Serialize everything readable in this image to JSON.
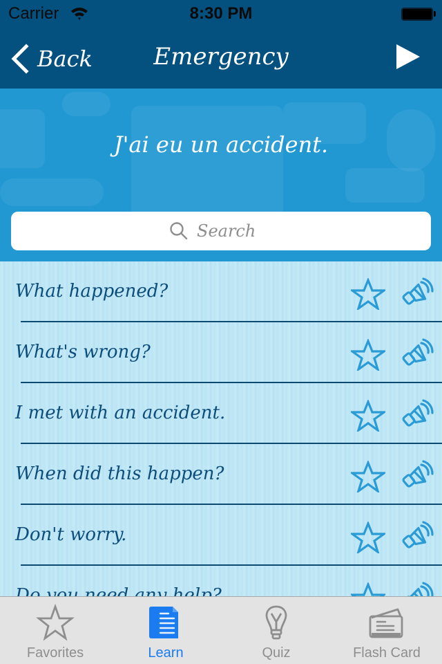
{
  "status_bar": {
    "carrier": "Carrier",
    "time": "8:30 PM"
  },
  "nav": {
    "back_label": "Back",
    "title": "Emergency",
    "play_icon": "play-icon"
  },
  "hero": {
    "phrase": "J'ai eu un accident."
  },
  "search": {
    "placeholder": "Search",
    "value": ""
  },
  "phrases": [
    {
      "text": "What happened?"
    },
    {
      "text": "What's wrong?"
    },
    {
      "text": "I met with an accident."
    },
    {
      "text": "When did this happen?"
    },
    {
      "text": "Don't worry."
    },
    {
      "text": "Do you need any help?"
    }
  ],
  "row_icons": {
    "favorite": "star-icon",
    "audio": "speaker-icon"
  },
  "tabs": [
    {
      "label": "Favorites",
      "icon": "star-icon",
      "active": false
    },
    {
      "label": "Learn",
      "icon": "document-icon",
      "active": true
    },
    {
      "label": "Quiz",
      "icon": "lightbulb-icon",
      "active": false
    },
    {
      "label": "Flash Card",
      "icon": "flashcard-icon",
      "active": false
    }
  ],
  "colors": {
    "nav_bar": "#04517f",
    "hero": "#2298d3",
    "list_bg": "#bde6f5",
    "phrase_text": "#0d4d7a",
    "row_icon": "#2a9bd4",
    "tab_active": "#1a7cf0",
    "tab_inactive": "#8e8e8e"
  }
}
